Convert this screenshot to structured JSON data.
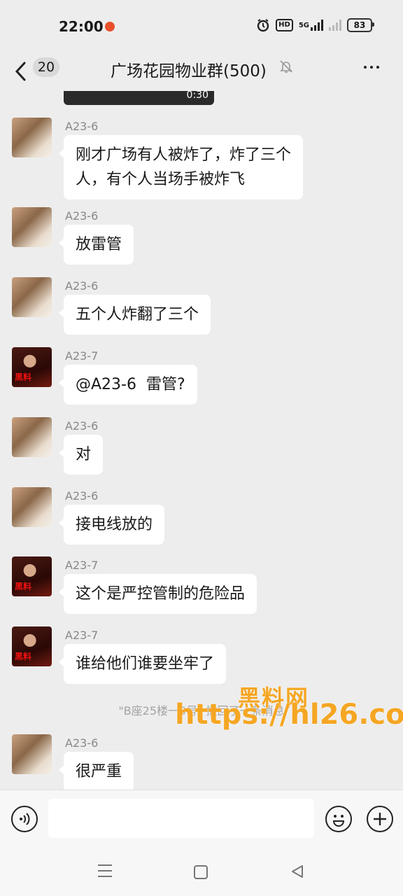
{
  "status_bar": {
    "time": "22:00",
    "hd_label": "HD",
    "network_label": "5G",
    "battery": "83"
  },
  "header": {
    "back_count": "20",
    "title": "广场花园物业群(500)"
  },
  "media": {
    "duration": "0:30"
  },
  "messages": [
    {
      "sender": "A23-6",
      "text": "刚才广场有人被炸了，炸了三个\n人，有个人当场手被炸飞"
    },
    {
      "sender": "A23-6",
      "text": "放雷管"
    },
    {
      "sender": "A23-6",
      "text": "五个人炸翻了三个"
    },
    {
      "sender": "A23-7",
      "text": "@A23-6  雷管?"
    },
    {
      "sender": "A23-6",
      "text": "对"
    },
    {
      "sender": "A23-6",
      "text": "接电线放的"
    },
    {
      "sender": "A23-7",
      "text": "这个是严控管制的危险品"
    },
    {
      "sender": "A23-7",
      "text": "谁给他们谁要坐牢了"
    },
    {
      "sender": "A23-6",
      "text": "很严重"
    }
  ],
  "system_notice": "\"B座25楼一3号\" 撤回了一条消息",
  "watermark": {
    "line1": "黑料网",
    "line2": "https://hl26.co"
  },
  "colors": {
    "background": "#ededed",
    "bubble": "#ffffff",
    "watermark": "#f5a623"
  }
}
